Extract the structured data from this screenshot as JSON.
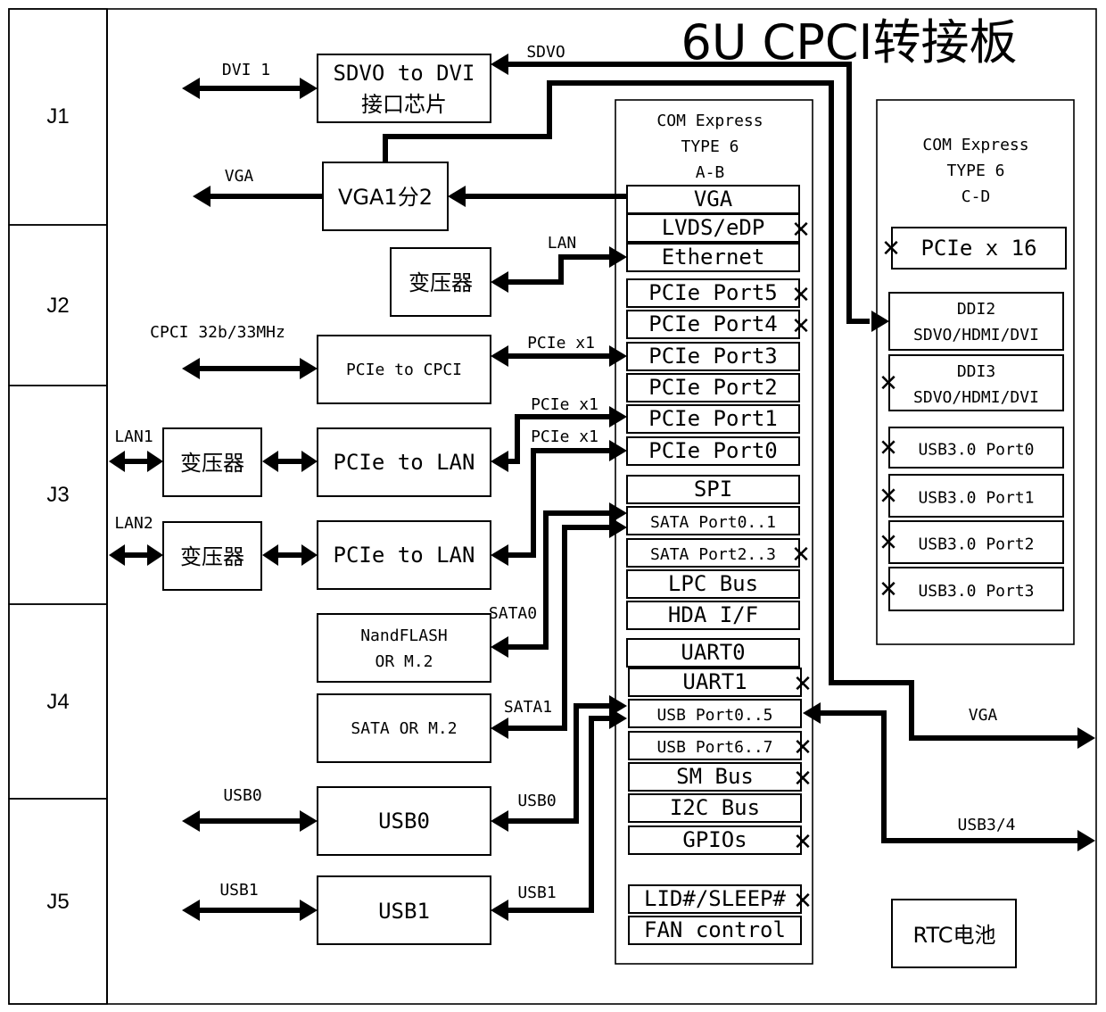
{
  "title": "6U CPCI转接板",
  "connectors": [
    "J1",
    "J2",
    "J3",
    "J4",
    "J5"
  ],
  "left_blocks": {
    "sdvo_dvi": {
      "line1": "SDVO to DVI",
      "line2": "接口芯片"
    },
    "vga_split": "VGA1分2",
    "transformer_lan": "变压器",
    "pcie_cpci": "PCIe to CPCI",
    "transformer1": "变压器",
    "pcie_lan1": "PCIe to LAN",
    "transformer2": "变压器",
    "pcie_lan2": "PCIe to LAN",
    "nand": {
      "line1": "NandFLASH",
      "line2": "OR M.2"
    },
    "sata_m2": "SATA OR M.2",
    "usb0": "USB0",
    "usb1": "USB1",
    "rtc": "RTC电池"
  },
  "signal_labels": {
    "dvi1": "DVI 1",
    "sdvo": "SDVO",
    "vga_left": "VGA",
    "lan": "LAN",
    "cpci_bus": "CPCI 32b/33MHz",
    "pcie_x1_a": "PCIe x1",
    "pcie_x1_b": "PCIe x1",
    "pcie_x1_c": "PCIe x1",
    "lan1": "LAN1",
    "lan2": "LAN2",
    "sata0": "SATA0",
    "sata1": "SATA1",
    "usb0_left": "USB0",
    "usb0_right": "USB0",
    "usb1_left": "USB1",
    "usb1_right": "USB1",
    "vga_right": "VGA",
    "usb34": "USB3/4"
  },
  "com_ab": {
    "header": [
      "COM Express",
      "TYPE 6",
      "A-B"
    ],
    "ports": [
      {
        "label": "VGA",
        "unused": false
      },
      {
        "label": "LVDS/eDP",
        "unused": true
      },
      {
        "label": "Ethernet",
        "unused": false
      },
      {
        "label": "PCIe Port5",
        "unused": true
      },
      {
        "label": "PCIe Port4",
        "unused": true
      },
      {
        "label": "PCIe Port3",
        "unused": false
      },
      {
        "label": "PCIe Port2",
        "unused": false
      },
      {
        "label": "PCIe Port1",
        "unused": false
      },
      {
        "label": "PCIe Port0",
        "unused": false
      },
      {
        "label": "SPI",
        "unused": false
      },
      {
        "label": "SATA Port0..1",
        "unused": false
      },
      {
        "label": "SATA Port2..3",
        "unused": true
      },
      {
        "label": "LPC Bus",
        "unused": false
      },
      {
        "label": "HDA I/F",
        "unused": false
      },
      {
        "label": "UART0",
        "unused": false
      },
      {
        "label": "UART1",
        "unused": true
      },
      {
        "label": "USB Port0..5",
        "unused": false
      },
      {
        "label": "USB Port6..7",
        "unused": true
      },
      {
        "label": "SM Bus",
        "unused": true
      },
      {
        "label": "I2C Bus",
        "unused": false
      },
      {
        "label": "GPIOs",
        "unused": true
      },
      {
        "label": "LID#/SLEEP#",
        "unused": true
      },
      {
        "label": "FAN control",
        "unused": false
      }
    ]
  },
  "com_cd": {
    "header": [
      "COM Express",
      "TYPE 6",
      "C-D"
    ],
    "ports": [
      {
        "label": "PCIe x 16",
        "unused": true
      },
      {
        "line1": "DDI2",
        "line2": "SDVO/HDMI/DVI",
        "unused": false
      },
      {
        "line1": "DDI3",
        "line2": "SDVO/HDMI/DVI",
        "unused": true
      },
      {
        "label": "USB3.0 Port0",
        "unused": true
      },
      {
        "label": "USB3.0 Port1",
        "unused": true
      },
      {
        "label": "USB3.0 Port2",
        "unused": true
      },
      {
        "label": "USB3.0 Port3",
        "unused": true
      }
    ]
  },
  "unused_mark": "✕"
}
